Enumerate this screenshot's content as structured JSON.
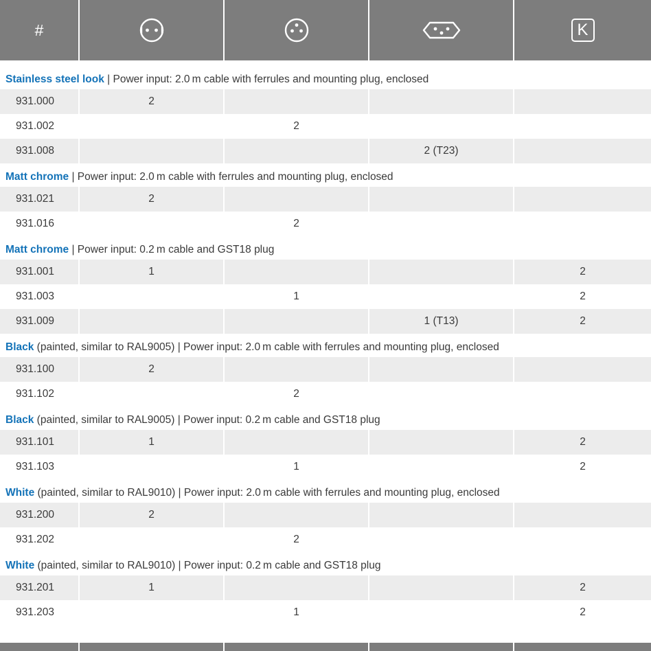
{
  "header": {
    "hash_label": "#",
    "columns": [
      {
        "icon": "schuko-socket-icon"
      },
      {
        "icon": "french-socket-icon"
      },
      {
        "icon": "swiss-socket-icon"
      },
      {
        "icon": "k-plug-icon",
        "label": "K"
      }
    ]
  },
  "groups": [
    {
      "name": "Stainless steel look",
      "rest": " | Power input: 2.0 m cable with ferrules and mounting plug, enclosed",
      "rows": [
        {
          "id": "931.000",
          "c1": "2",
          "c2": "",
          "c3": "",
          "c4": ""
        },
        {
          "id": "931.002",
          "c1": "",
          "c2": "2",
          "c3": "",
          "c4": ""
        },
        {
          "id": "931.008",
          "c1": "",
          "c2": "",
          "c3": "2 (T23)",
          "c4": ""
        }
      ]
    },
    {
      "name": "Matt chrome",
      "rest": " | Power input: 2.0 m cable with ferrules and mounting plug, enclosed",
      "rows": [
        {
          "id": "931.021",
          "c1": "2",
          "c2": "",
          "c3": "",
          "c4": ""
        },
        {
          "id": "931.016",
          "c1": "",
          "c2": "2",
          "c3": "",
          "c4": ""
        }
      ]
    },
    {
      "name": "Matt chrome",
      "rest": " | Power input: 0.2 m cable and GST18 plug",
      "rows": [
        {
          "id": "931.001",
          "c1": "1",
          "c2": "",
          "c3": "",
          "c4": "2"
        },
        {
          "id": "931.003",
          "c1": "",
          "c2": "1",
          "c3": "",
          "c4": "2"
        },
        {
          "id": "931.009",
          "c1": "",
          "c2": "",
          "c3": "1 (T13)",
          "c4": "2"
        }
      ]
    },
    {
      "name": "Black",
      "rest": " (painted, similar to RAL9005) | Power input: 2.0 m cable with ferrules and mounting plug, enclosed",
      "rows": [
        {
          "id": "931.100",
          "c1": "2",
          "c2": "",
          "c3": "",
          "c4": ""
        },
        {
          "id": "931.102",
          "c1": "",
          "c2": "2",
          "c3": "",
          "c4": ""
        }
      ]
    },
    {
      "name": "Black",
      "rest": " (painted, similar to RAL9005) | Power input: 0.2 m cable and GST18 plug",
      "rows": [
        {
          "id": "931.101",
          "c1": "1",
          "c2": "",
          "c3": "",
          "c4": "2"
        },
        {
          "id": "931.103",
          "c1": "",
          "c2": "1",
          "c3": "",
          "c4": "2"
        }
      ]
    },
    {
      "name": "White",
      "rest": " (painted, similar to RAL9010) | Power input: 2.0 m cable with ferrules and mounting plug, enclosed",
      "rows": [
        {
          "id": "931.200",
          "c1": "2",
          "c2": "",
          "c3": "",
          "c4": ""
        },
        {
          "id": "931.202",
          "c1": "",
          "c2": "2",
          "c3": "",
          "c4": ""
        }
      ]
    },
    {
      "name": "White",
      "rest": " (painted, similar to RAL9010) | Power input: 0.2 m cable and GST18 plug",
      "rows": [
        {
          "id": "931.201",
          "c1": "1",
          "c2": "",
          "c3": "",
          "c4": "2"
        },
        {
          "id": "931.203",
          "c1": "",
          "c2": "1",
          "c3": "",
          "c4": "2"
        }
      ]
    }
  ],
  "colors": {
    "header_bg": "#7d7d7d",
    "accent_blue": "#1473b8",
    "row_shade": "#ececec",
    "text": "#3a3a3a"
  }
}
